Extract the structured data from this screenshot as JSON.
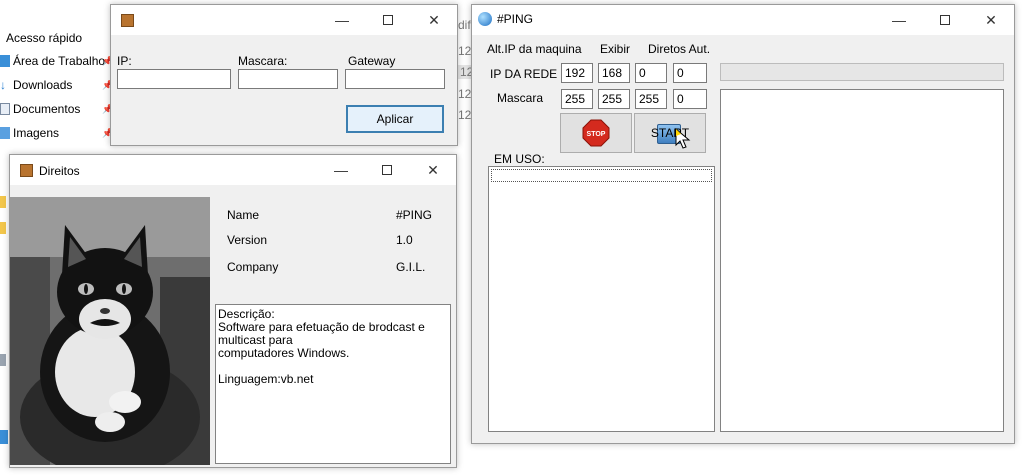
{
  "explorer": {
    "quick_access_label": "Acesso rápido",
    "items": [
      {
        "label": "Área de Trabalho",
        "icon": "desktop-folder-icon"
      },
      {
        "label": "Downloads",
        "icon": "download-arrow-icon"
      },
      {
        "label": "Documentos",
        "icon": "document-icon"
      },
      {
        "label": "Imagens",
        "icon": "pictures-icon"
      }
    ],
    "fragments": [
      "dif",
      "12",
      "12",
      "12",
      "12"
    ]
  },
  "ip_window": {
    "ip_label": "IP:",
    "mask_label": "Mascara:",
    "gateway_label": "Gateway",
    "ip_value": "",
    "mask_value": "",
    "gateway_value": "",
    "apply_label": "Aplicar"
  },
  "about_window": {
    "title": "Direitos",
    "name_label": "Name",
    "name_value": "#PING",
    "version_label": "Version",
    "version_value": "1.0",
    "company_label": "Company",
    "company_value": "G.I.L.",
    "description": "Descrição:\nSoftware para efetuação de brodcast e multicast para\ncomputadores Windows.\n\nLinguagem:vb.net"
  },
  "ping_window": {
    "title": "#PING",
    "menu": [
      "Alt.IP da maquina",
      "Exibir",
      "Diretos Aut."
    ],
    "network_ip_label": "IP DA REDE",
    "network_ip": [
      "192",
      "168",
      "0",
      "0"
    ],
    "mask_label": "Mascara",
    "mask": [
      "255",
      "255",
      "255",
      "0"
    ],
    "stop_label": "STOP",
    "start_label": "START",
    "in_use_label": "EM USO:",
    "progress": 0
  }
}
